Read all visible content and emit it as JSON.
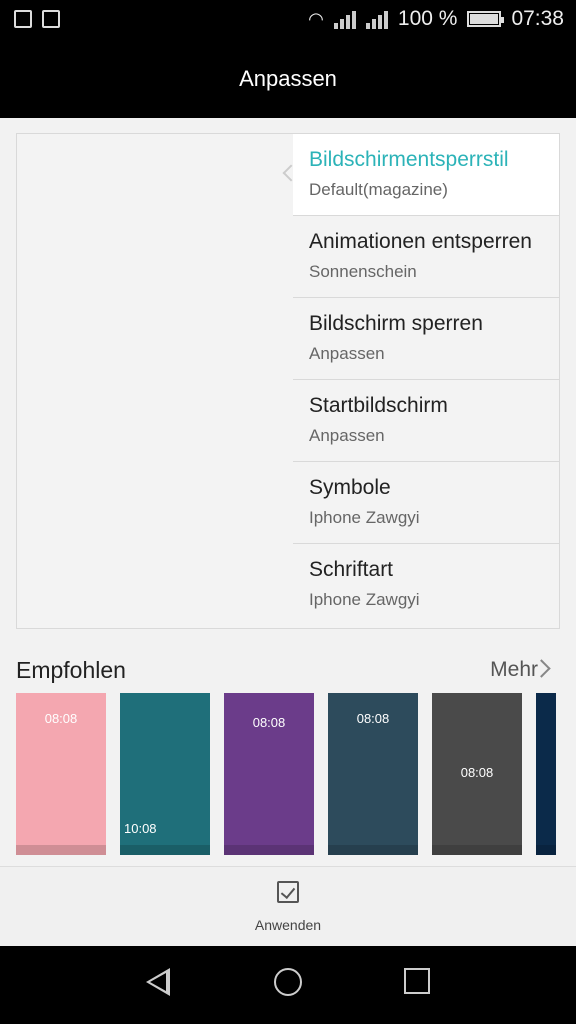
{
  "status": {
    "battery_pct": "100 %",
    "time": "07:38"
  },
  "header": {
    "title": "Anpassen"
  },
  "menu": [
    {
      "title": "Bildschirmentsperrstil",
      "value": "Default(magazine)",
      "active": true
    },
    {
      "title": "Animationen entsperren",
      "value": "Sonnenschein"
    },
    {
      "title": "Bildschirm sperren",
      "value": "Anpassen"
    },
    {
      "title": "Startbildschirm",
      "value": "Anpassen"
    },
    {
      "title": "Symbole",
      "value": "Iphone Zawgyi"
    },
    {
      "title": "Schriftart",
      "value": "Iphone Zawgyi"
    }
  ],
  "recommended": {
    "title": "Empfohlen",
    "more": "Mehr",
    "themes": [
      {
        "time": "08:08",
        "color": "#f4a7b0"
      },
      {
        "time": "10:08",
        "color": "#1f6f7a"
      },
      {
        "time": "08:08",
        "color": "#6b3c8a"
      },
      {
        "time": "08:08",
        "color": "#2d4b5c"
      },
      {
        "time": "08:08",
        "color": "#4a4a4a"
      },
      {
        "time": "",
        "color": "#0b2a4a"
      }
    ]
  },
  "toolbar": {
    "apply_label": "Anwenden"
  },
  "icons": [
    "facebook-icon",
    "gallery-icon",
    "wifi-icon",
    "signal-icon",
    "battery-icon",
    "checkbox-icon",
    "back-icon",
    "home-icon",
    "recents-icon",
    "chevron-right-icon",
    "chevron-left-icon"
  ]
}
